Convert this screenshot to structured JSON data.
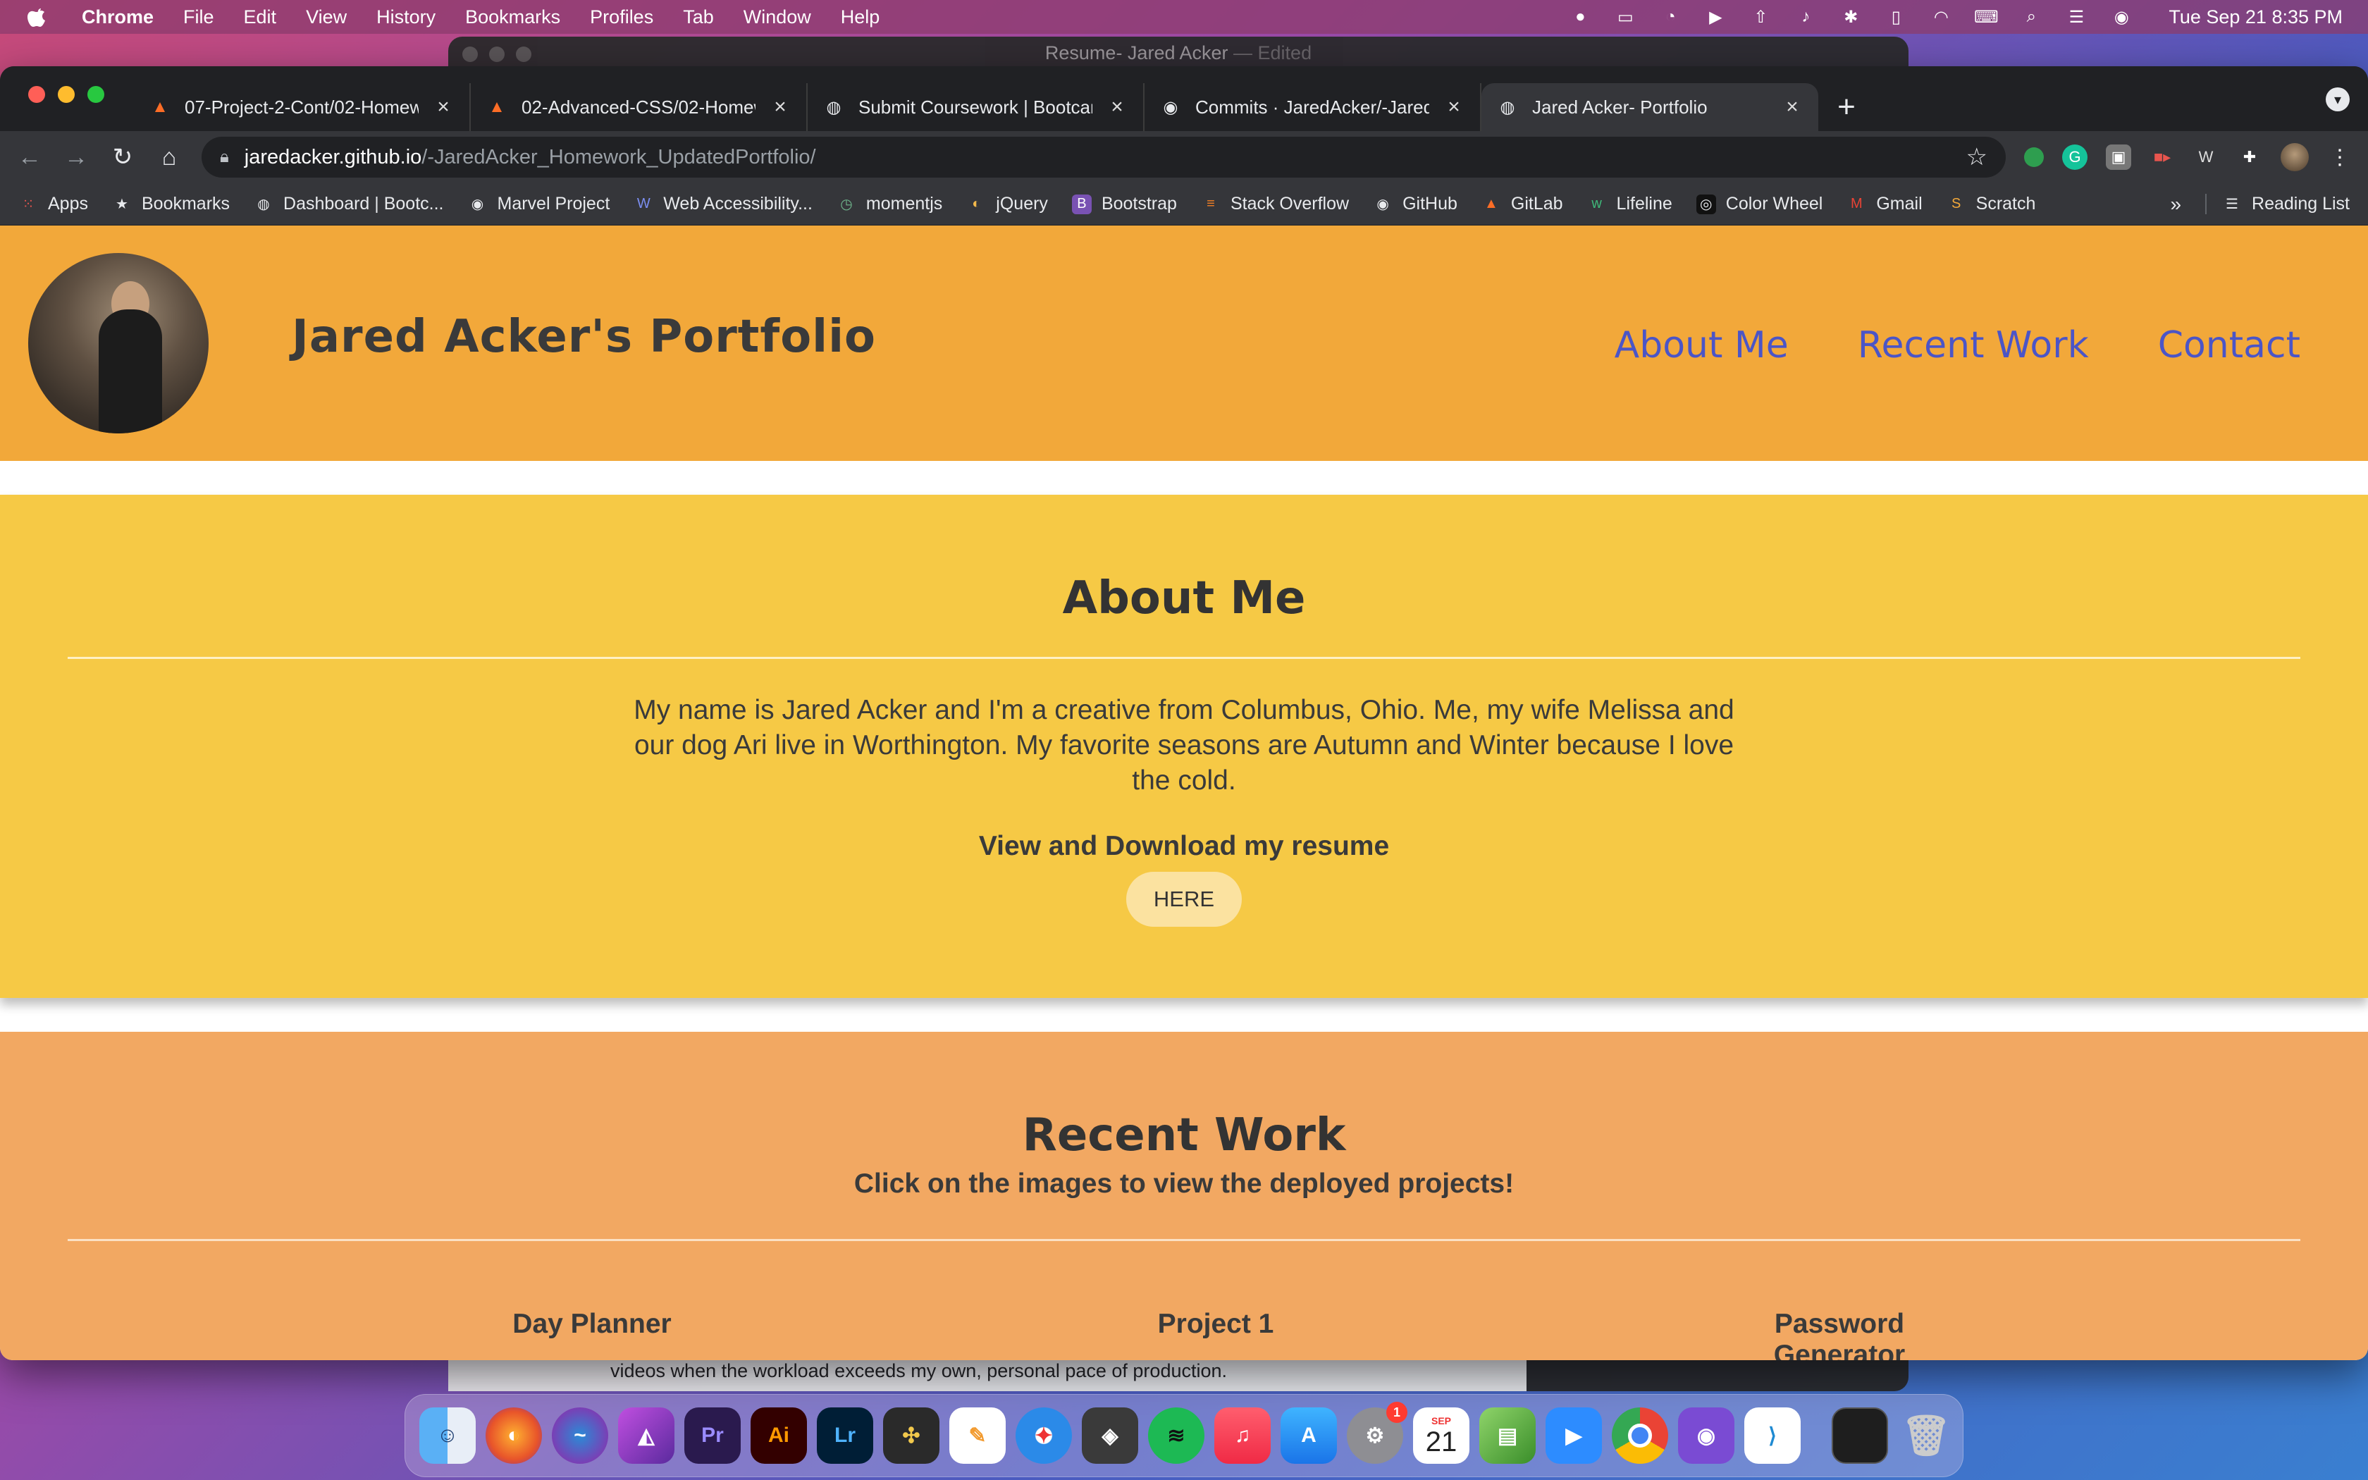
{
  "menubar": {
    "app_name": "Chrome",
    "items": [
      "File",
      "Edit",
      "View",
      "History",
      "Bookmarks",
      "Profiles",
      "Tab",
      "Window",
      "Help"
    ],
    "clock": "Tue Sep 21  8:35 PM"
  },
  "background_window": {
    "title": "Resume- Jared Acker",
    "title_suffix": "— Edited",
    "bottom_text": "videos when the workload exceeds my own, personal pace of production."
  },
  "tabs": [
    {
      "title": "07-Project-2-Cont/02-Homew",
      "icon": "gitlab-icon"
    },
    {
      "title": "02-Advanced-CSS/02-Homew",
      "icon": "gitlab-icon"
    },
    {
      "title": "Submit Coursework | Bootcamp",
      "icon": "globe-icon"
    },
    {
      "title": "Commits · JaredAcker/-JaredA",
      "icon": "github-icon"
    },
    {
      "title": "Jared Acker- Portfolio",
      "icon": "globe-icon"
    }
  ],
  "address_bar": {
    "host": "jaredacker.github.io",
    "path": "/-JaredAcker_Homework_UpdatedPortfolio/"
  },
  "bookmarks": [
    {
      "label": "Apps",
      "icon": "apps-grid-icon"
    },
    {
      "label": "Bookmarks",
      "icon": "star-icon"
    },
    {
      "label": "Dashboard | Bootc...",
      "icon": "globe-icon"
    },
    {
      "label": "Marvel Project",
      "icon": "github-icon"
    },
    {
      "label": "Web Accessibility...",
      "icon": "wave-icon"
    },
    {
      "label": "momentjs",
      "icon": "clock-icon"
    },
    {
      "label": "jQuery",
      "icon": "jquery-icon"
    },
    {
      "label": "Bootstrap",
      "icon": "bootstrap-icon"
    },
    {
      "label": "Stack Overflow",
      "icon": "stackoverflow-icon"
    },
    {
      "label": "GitHub",
      "icon": "github-icon"
    },
    {
      "label": "GitLab",
      "icon": "gitlab-icon"
    },
    {
      "label": "Lifeline",
      "icon": "lifeline-icon"
    },
    {
      "label": "Color Wheel",
      "icon": "color-wheel-icon"
    },
    {
      "label": "Gmail",
      "icon": "gmail-icon"
    },
    {
      "label": "Scratch",
      "icon": "scratch-icon"
    }
  ],
  "bookmarks_more": "»",
  "reading_list": "Reading List",
  "site": {
    "title": "Jared Acker's Portfolio",
    "nav": [
      "About Me",
      "Recent Work",
      "Contact"
    ],
    "about": {
      "heading": "About Me",
      "text": "My name is Jared Acker and I'm a creative from Columbus, Ohio. Me, my wife Melissa and our dog Ari live in Worthington. My favorite seasons are Autumn and Winter because I love the cold.",
      "resume_label": "View and Download my resume",
      "resume_button": "HERE"
    },
    "recent": {
      "heading": "Recent Work",
      "subheading": "Click on the images to view the deployed projects!",
      "projects": [
        "Day Planner",
        "Project 1",
        "Password Generator"
      ]
    }
  },
  "dock": {
    "apps": [
      "Finder",
      "Firefox",
      "Siri",
      "Affinity Photo",
      "Pr",
      "Ai",
      "Lr",
      "DaVinci Resolve",
      "Pages",
      "Safari",
      "Compressor",
      "Spotify",
      "Music",
      "App Store",
      "System Preferences",
      "Calendar",
      "Movie Maker",
      "Zoom",
      "Chrome",
      "GitHub Desktop",
      "VS Code"
    ],
    "calendar_month": "SEP",
    "calendar_day": "21",
    "sysprefs_badge": "1"
  },
  "colors": {
    "header": "#f2a83a",
    "about_bg": "#f6c945",
    "recent_bg": "#f2a862",
    "nav_link": "#4b55c7"
  }
}
